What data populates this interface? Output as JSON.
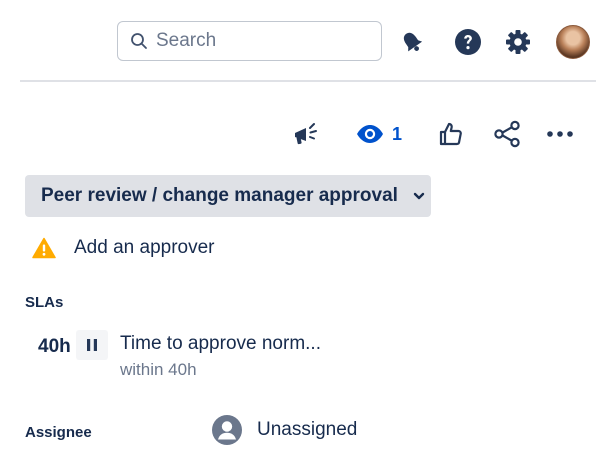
{
  "topbar": {
    "search": {
      "placeholder": "Search"
    },
    "icons": [
      "notification-bell-icon",
      "help-icon",
      "settings-gear-icon",
      "user-avatar"
    ]
  },
  "actions": {
    "watch_count": "1",
    "icons": [
      "feedback-megaphone-icon",
      "watch-eye-icon",
      "like-thumb-icon",
      "share-icon",
      "more-options-icon"
    ]
  },
  "status": {
    "label": "Peer review / change manager approval"
  },
  "approver": {
    "label": "Add an approver"
  },
  "sla": {
    "heading": "SLAs",
    "items": [
      {
        "time": "40h",
        "name": "Time to approve norm...",
        "target": "within 40h"
      }
    ]
  },
  "assignee": {
    "label": "Assignee",
    "value": "Unassigned"
  },
  "colors": {
    "primary_blue": "#0052cc",
    "text": "#172b4d",
    "subtle_text": "#6b778c",
    "warning": "#ffab00",
    "status_bg": "#dfe1e6"
  }
}
